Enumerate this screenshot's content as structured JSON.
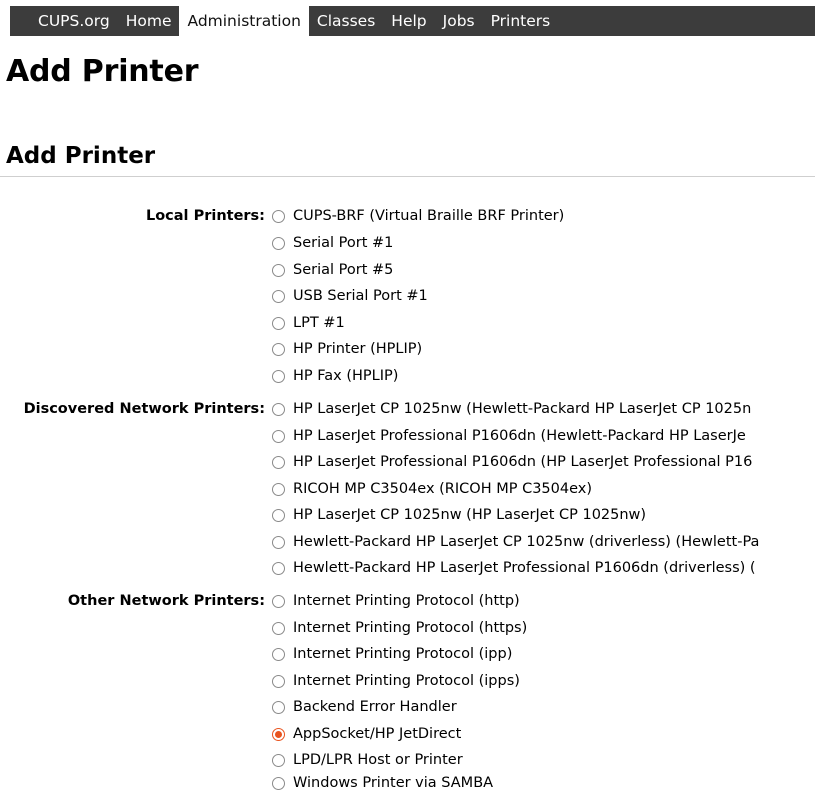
{
  "nav": {
    "items": [
      "CUPS.org",
      "Home",
      "Administration",
      "Classes",
      "Help",
      "Jobs",
      "Printers"
    ],
    "active_index": 2
  },
  "page_title": "Add Printer",
  "section_title": "Add Printer",
  "groups": [
    {
      "label": "Local Printers:",
      "options": [
        "CUPS-BRF (Virtual Braille BRF Printer)",
        "Serial Port #1",
        "Serial Port #5",
        "USB Serial Port #1",
        "LPT #1",
        "HP Printer (HPLIP)",
        "HP Fax (HPLIP)"
      ]
    },
    {
      "label": "Discovered Network Printers:",
      "options": [
        "HP LaserJet CP 1025nw (Hewlett-Packard HP LaserJet CP 1025n",
        "HP LaserJet Professional P1606dn (Hewlett-Packard HP LaserJe",
        "HP LaserJet Professional P1606dn (HP LaserJet Professional P16",
        "RICOH MP C3504ex (RICOH MP C3504ex)",
        "HP LaserJet CP 1025nw (HP LaserJet CP 1025nw)",
        "Hewlett-Packard HP LaserJet CP 1025nw (driverless) (Hewlett-Pa",
        "Hewlett-Packard HP LaserJet Professional P1606dn (driverless) ("
      ]
    },
    {
      "label": "Other Network Printers:",
      "options": [
        "Internet Printing Protocol (http)",
        "Internet Printing Protocol (https)",
        "Internet Printing Protocol (ipp)",
        "Internet Printing Protocol (ipps)",
        "Backend Error Handler",
        "AppSocket/HP JetDirect",
        "LPD/LPR Host or Printer",
        "Windows Printer via SAMBA"
      ]
    }
  ],
  "selected_option": "AppSocket/HP JetDirect",
  "colors": {
    "nav_background": "#3c3c3c",
    "radio_selected": "#e9541f"
  }
}
